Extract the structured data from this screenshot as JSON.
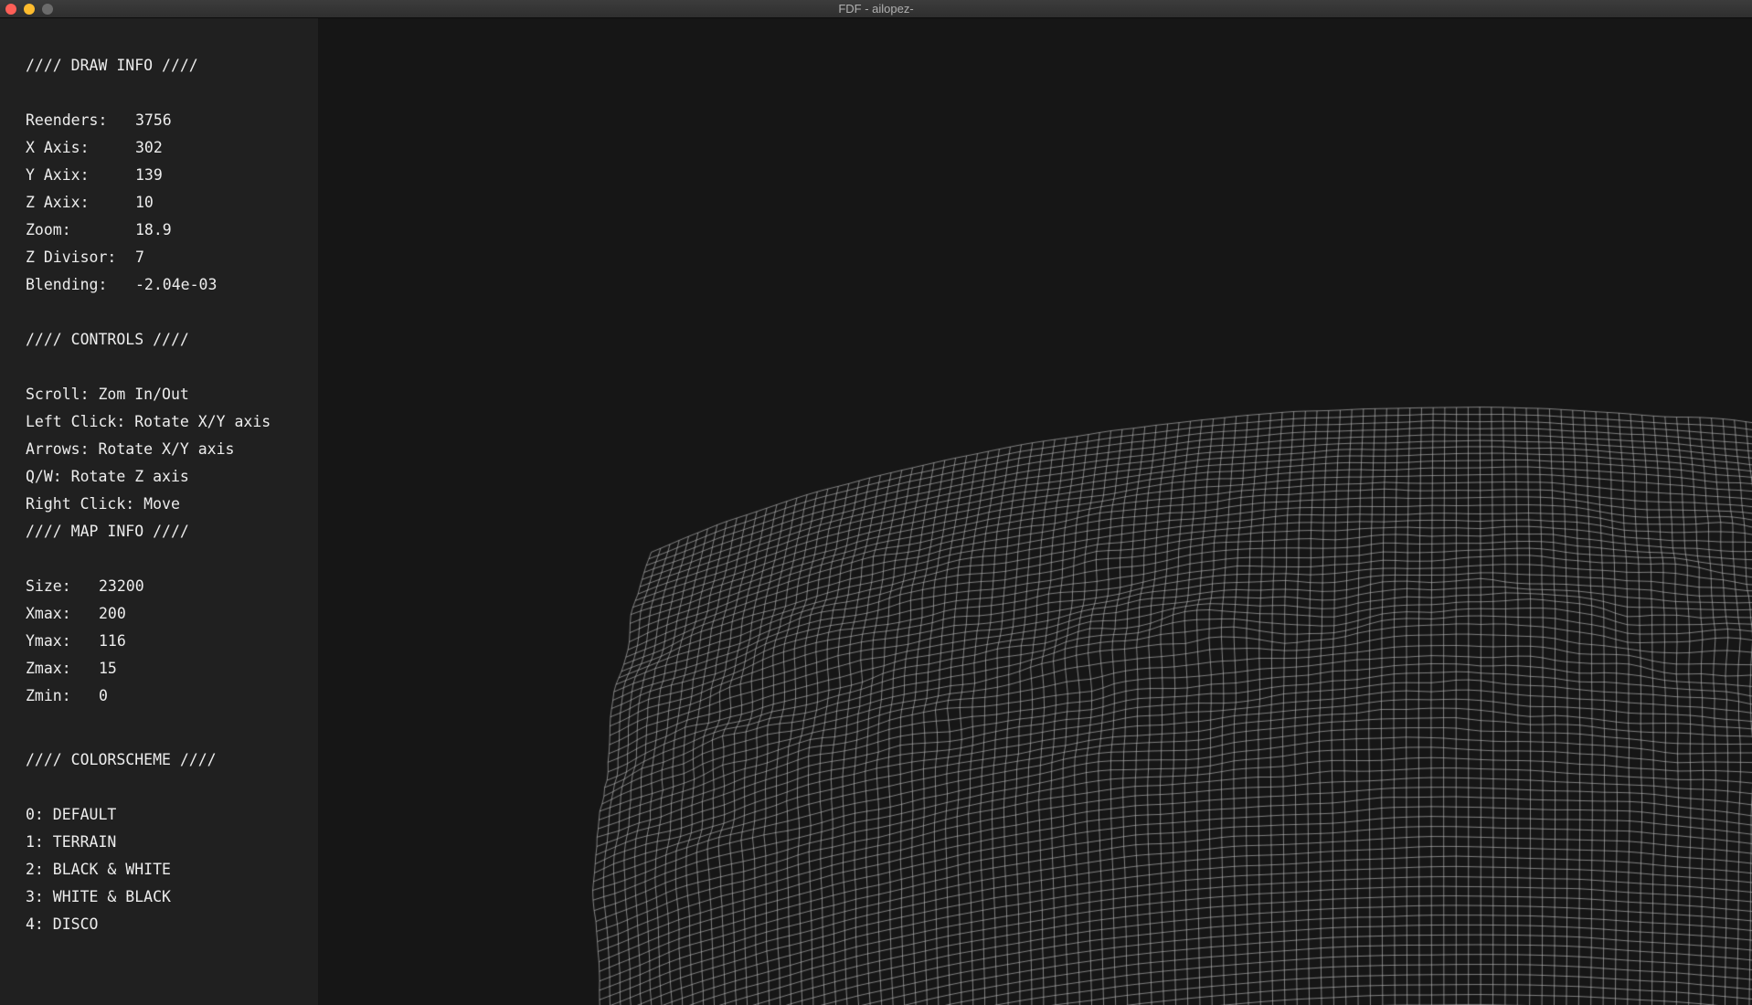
{
  "window": {
    "title": "FDF - ailopez-",
    "traffic_lights": {
      "close": "#fe5f57",
      "minimize": "#febc2e",
      "maximize": "#6b6b6b"
    }
  },
  "colors": {
    "background": "#161616",
    "sidebar": "#222222",
    "text": "#ededed",
    "wire": "#d8d8d8"
  },
  "draw_info": {
    "title": "//// DRAW INFO ////",
    "rows": [
      {
        "label": "Reenders:",
        "value": "3756"
      },
      {
        "label": "X Axis:",
        "value": "302"
      },
      {
        "label": "Y Axix:",
        "value": "139"
      },
      {
        "label": "Z Axix:",
        "value": "10"
      },
      {
        "label": "Zoom:",
        "value": "18.9"
      },
      {
        "label": "Z Divisor:",
        "value": "7"
      },
      {
        "label": "Blending:",
        "value": "-2.04e-03"
      }
    ]
  },
  "controls": {
    "title": "//// CONTROLS ////",
    "items": [
      "Scroll: Zom In/Out",
      "Left Click: Rotate X/Y axis",
      "Arrows: Rotate X/Y axis",
      "Q/W: Rotate Z axis",
      "Right Click: Move"
    ]
  },
  "map_info": {
    "title": "//// MAP INFO ////",
    "rows": [
      {
        "label": "Size:",
        "value": "23200"
      },
      {
        "label": "Xmax:",
        "value": "200"
      },
      {
        "label": "Ymax:",
        "value": "116"
      },
      {
        "label": "Zmax:",
        "value": "15"
      },
      {
        "label": "Zmin:",
        "value": "0"
      }
    ]
  },
  "colorscheme": {
    "title": "//// COLORSCHEME ////",
    "items": [
      "0: DEFAULT",
      "1: TERRAIN",
      "2: BLACK & WHITE",
      "3: WHITE & BLACK",
      "4: DISCO"
    ]
  }
}
